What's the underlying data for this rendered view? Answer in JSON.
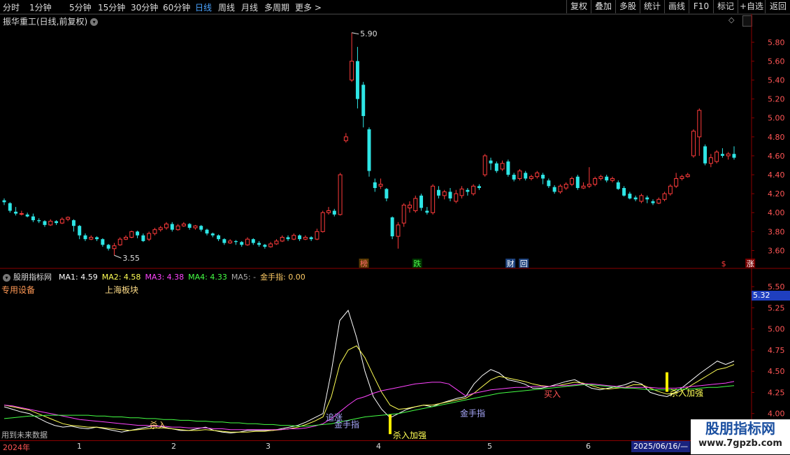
{
  "toolbar": {
    "tabs": [
      "分时",
      "1分钟",
      "5分钟",
      "15分钟",
      "30分钟",
      "60分钟",
      "日线",
      "周线",
      "月线",
      "多周期",
      "更多 >"
    ],
    "active_tab": "日线",
    "right_buttons": [
      "复权",
      "叠加",
      "多股",
      "统计",
      "画线",
      "F10",
      "标记",
      "+自选",
      "返回"
    ]
  },
  "stock": {
    "title": "振华重工(日线,前复权)",
    "high_label": "5.90",
    "low_label": "3.55"
  },
  "price_axis": [
    "5.80",
    "5.60",
    "5.40",
    "5.20",
    "5.00",
    "4.80",
    "4.60",
    "4.40",
    "4.20",
    "4.00",
    "3.80",
    "3.60"
  ],
  "price_range": [
    3.5,
    5.95
  ],
  "markers": [
    {
      "text": "榜",
      "color": "#ff6a6a",
      "bg": "#5a3a00",
      "index": 27
    },
    {
      "text": "跌",
      "color": "#4cff4c",
      "bg": "#003300",
      "index": 31
    },
    {
      "text": "财",
      "color": "#ffffff",
      "bg": "#1a3f7a",
      "index": 38
    },
    {
      "text": "回",
      "color": "#ffffff",
      "bg": "#1a3f7a",
      "index": 39
    },
    {
      "text": "$",
      "color": "#ff3a3a",
      "bg": "#000000",
      "index": 54
    },
    {
      "text": "涨",
      "color": "#ffffff",
      "bg": "#7a0000",
      "index": 56
    }
  ],
  "candles": [
    [
      4.13,
      4.11,
      4.15,
      4.08
    ],
    [
      4.1,
      4.02,
      4.11,
      4.0
    ],
    [
      4.01,
      3.99,
      4.06,
      3.97
    ],
    [
      3.99,
      3.99,
      4.02,
      3.97
    ],
    [
      3.98,
      3.96,
      4.0,
      3.95
    ],
    [
      3.96,
      3.92,
      3.99,
      3.9
    ],
    [
      3.92,
      3.91,
      3.94,
      3.89
    ],
    [
      3.91,
      3.87,
      3.92,
      3.85
    ],
    [
      3.87,
      3.91,
      3.93,
      3.86
    ],
    [
      3.91,
      3.89,
      3.92,
      3.87
    ],
    [
      3.89,
      3.93,
      3.95,
      3.88
    ],
    [
      3.93,
      3.95,
      3.96,
      3.91
    ],
    [
      3.92,
      3.86,
      3.93,
      3.8
    ],
    [
      3.86,
      3.76,
      3.87,
      3.72
    ],
    [
      3.76,
      3.72,
      3.78,
      3.7
    ],
    [
      3.72,
      3.74,
      3.76,
      3.71
    ],
    [
      3.74,
      3.72,
      3.75,
      3.7
    ],
    [
      3.72,
      3.66,
      3.73,
      3.64
    ],
    [
      3.66,
      3.62,
      3.67,
      3.6
    ],
    [
      3.62,
      3.65,
      3.68,
      3.55
    ],
    [
      3.66,
      3.72,
      3.74,
      3.65
    ],
    [
      3.72,
      3.74,
      3.76,
      3.71
    ],
    [
      3.74,
      3.8,
      3.81,
      3.73
    ],
    [
      3.8,
      3.76,
      3.81,
      3.73
    ],
    [
      3.76,
      3.7,
      3.78,
      3.69
    ],
    [
      3.72,
      3.78,
      3.8,
      3.7
    ],
    [
      3.78,
      3.82,
      3.84,
      3.76
    ],
    [
      3.82,
      3.84,
      3.86,
      3.8
    ],
    [
      3.84,
      3.88,
      3.9,
      3.82
    ],
    [
      3.88,
      3.82,
      3.9,
      3.8
    ],
    [
      3.82,
      3.86,
      3.88,
      3.81
    ],
    [
      3.86,
      3.88,
      3.9,
      3.85
    ],
    [
      3.88,
      3.84,
      3.89,
      3.82
    ],
    [
      3.84,
      3.86,
      3.87,
      3.82
    ],
    [
      3.86,
      3.82,
      3.87,
      3.8
    ],
    [
      3.82,
      3.78,
      3.83,
      3.76
    ],
    [
      3.78,
      3.76,
      3.79,
      3.74
    ],
    [
      3.76,
      3.72,
      3.77,
      3.7
    ],
    [
      3.72,
      3.68,
      3.73,
      3.66
    ],
    [
      3.68,
      3.7,
      3.72,
      3.67
    ],
    [
      3.7,
      3.69,
      3.71,
      3.66
    ],
    [
      3.69,
      3.66,
      3.7,
      3.64
    ],
    [
      3.66,
      3.72,
      3.74,
      3.65
    ],
    [
      3.72,
      3.68,
      3.73,
      3.66
    ],
    [
      3.68,
      3.66,
      3.7,
      3.64
    ],
    [
      3.66,
      3.64,
      3.67,
      3.62
    ],
    [
      3.64,
      3.67,
      3.69,
      3.63
    ],
    [
      3.67,
      3.7,
      3.72,
      3.66
    ],
    [
      3.7,
      3.74,
      3.76,
      3.69
    ],
    [
      3.74,
      3.72,
      3.76,
      3.7
    ],
    [
      3.72,
      3.76,
      3.78,
      3.71
    ],
    [
      3.76,
      3.72,
      3.77,
      3.7
    ],
    [
      3.72,
      3.74,
      3.76,
      3.71
    ],
    [
      3.74,
      3.72,
      3.75,
      3.7
    ],
    [
      3.72,
      3.8,
      3.83,
      3.71
    ],
    [
      3.8,
      4.0,
      4.02,
      3.79
    ],
    [
      4.0,
      4.02,
      4.06,
      3.98
    ],
    [
      4.02,
      3.98,
      4.04,
      3.96
    ],
    [
      3.98,
      4.4,
      4.42,
      3.97
    ],
    [
      4.76,
      4.8,
      4.84,
      4.74
    ],
    [
      5.4,
      5.6,
      5.9,
      5.38
    ],
    [
      5.6,
      5.2,
      5.75,
      5.1
    ],
    [
      5.35,
      5.02,
      5.38,
      4.9
    ],
    [
      4.88,
      4.44,
      4.9,
      4.38
    ],
    [
      4.32,
      4.26,
      4.36,
      4.22
    ],
    [
      4.28,
      4.3,
      4.36,
      4.25
    ],
    [
      4.25,
      4.15,
      4.26,
      4.12
    ],
    [
      3.95,
      3.75,
      3.96,
      3.72
    ],
    [
      3.75,
      3.87,
      3.9,
      3.62
    ],
    [
      3.89,
      4.08,
      4.1,
      3.85
    ],
    [
      4.05,
      4.08,
      4.12,
      4.0
    ],
    [
      4.02,
      4.15,
      4.18,
      4.0
    ],
    [
      4.18,
      4.05,
      4.2,
      4.02
    ],
    [
      4.02,
      4.0,
      4.06,
      3.98
    ],
    [
      4.0,
      4.28,
      4.3,
      3.98
    ],
    [
      4.24,
      4.18,
      4.28,
      4.15
    ],
    [
      4.18,
      4.22,
      4.24,
      4.14
    ],
    [
      4.22,
      4.15,
      4.26,
      4.12
    ],
    [
      4.12,
      4.2,
      4.24,
      4.1
    ],
    [
      4.18,
      4.25,
      4.28,
      4.15
    ],
    [
      4.24,
      4.22,
      4.26,
      4.18
    ],
    [
      4.2,
      4.28,
      4.3,
      4.18
    ],
    [
      4.28,
      4.26,
      4.3,
      4.24
    ],
    [
      4.4,
      4.6,
      4.62,
      4.38
    ],
    [
      4.55,
      4.52,
      4.58,
      4.45
    ],
    [
      4.52,
      4.44,
      4.54,
      4.42
    ],
    [
      4.46,
      4.52,
      4.55,
      4.44
    ],
    [
      4.54,
      4.4,
      4.56,
      4.38
    ],
    [
      4.4,
      4.35,
      4.42,
      4.33
    ],
    [
      4.36,
      4.44,
      4.46,
      4.34
    ],
    [
      4.42,
      4.36,
      4.44,
      4.34
    ],
    [
      4.36,
      4.38,
      4.4,
      4.34
    ],
    [
      4.38,
      4.42,
      4.44,
      4.36
    ],
    [
      4.4,
      4.36,
      4.42,
      4.3
    ],
    [
      4.34,
      4.28,
      4.36,
      4.26
    ],
    [
      4.27,
      4.22,
      4.29,
      4.2
    ],
    [
      4.22,
      4.28,
      4.3,
      4.2
    ],
    [
      4.26,
      4.3,
      4.32,
      4.24
    ],
    [
      4.3,
      4.36,
      4.38,
      4.28
    ],
    [
      4.38,
      4.26,
      4.4,
      4.24
    ],
    [
      4.26,
      4.28,
      4.32,
      4.25
    ],
    [
      4.28,
      4.3,
      4.48,
      4.26
    ],
    [
      4.3,
      4.36,
      4.38,
      4.28
    ],
    [
      4.36,
      4.38,
      4.4,
      4.34
    ],
    [
      4.38,
      4.34,
      4.4,
      4.32
    ],
    [
      4.34,
      4.36,
      4.38,
      4.32
    ],
    [
      4.32,
      4.25,
      4.34,
      4.24
    ],
    [
      4.26,
      4.18,
      4.28,
      4.17
    ],
    [
      4.2,
      4.15,
      4.22,
      4.14
    ],
    [
      4.16,
      4.14,
      4.18,
      4.12
    ],
    [
      4.12,
      4.18,
      4.2,
      4.1
    ],
    [
      4.16,
      4.14,
      4.18,
      4.1
    ],
    [
      4.12,
      4.1,
      4.14,
      4.08
    ],
    [
      4.1,
      4.14,
      4.16,
      4.09
    ],
    [
      4.14,
      4.2,
      4.22,
      4.12
    ],
    [
      4.2,
      4.28,
      4.3,
      4.18
    ],
    [
      4.28,
      4.36,
      4.42,
      4.26
    ],
    [
      4.36,
      4.38,
      4.4,
      4.34
    ],
    [
      4.38,
      4.4,
      4.42,
      4.37
    ],
    [
      4.6,
      4.86,
      4.88,
      4.58
    ],
    [
      4.8,
      5.08,
      5.1,
      4.6
    ],
    [
      4.7,
      4.52,
      4.72,
      4.5
    ],
    [
      4.52,
      4.58,
      4.62,
      4.48
    ],
    [
      4.54,
      4.64,
      4.66,
      4.52
    ],
    [
      4.62,
      4.6,
      4.68,
      4.58
    ],
    [
      4.6,
      4.62,
      4.64,
      4.56
    ],
    [
      4.62,
      4.58,
      4.7,
      4.56
    ]
  ],
  "indicator": {
    "name": "股朋指标网",
    "ma_values": [
      {
        "label": "MA1: 4.59",
        "color": "#ffffff"
      },
      {
        "label": "MA2: 4.58",
        "color": "#ffff55"
      },
      {
        "label": "MA3: 4.38",
        "color": "#ff44ff"
      },
      {
        "label": "MA4: 4.33",
        "color": "#44ff44"
      },
      {
        "label": "MA5: -",
        "color": "#aaaaaa"
      },
      {
        "label": "金手指: 0.00",
        "color": "#ffcc66"
      }
    ],
    "sector1": "专用设备",
    "sector2": "上海板块",
    "axis": [
      "5.50",
      "5.25",
      "5.00",
      "4.75",
      "4.50",
      "4.25",
      "4.00"
    ],
    "current_price": "5.32",
    "range": [
      3.7,
      5.6
    ],
    "signal_labels": [
      {
        "text": "杀入",
        "color": "#ffcc66",
        "index": 17,
        "value": 3.86
      },
      {
        "text": "追涨",
        "color": "#aaaaff",
        "index": 38,
        "value": 3.95
      },
      {
        "text": "金手指",
        "color": "#aaaaff",
        "index": 39,
        "value": 3.87
      },
      {
        "text": "杀入加强",
        "color": "#ffff55",
        "index": 46,
        "value": 3.74
      },
      {
        "text": "金手指",
        "color": "#aaaaff",
        "index": 54,
        "value": 4.0
      },
      {
        "text": "买入",
        "color": "#ff5555",
        "index": 64,
        "value": 4.23
      },
      {
        "text": "杀入加强",
        "color": "#ffff55",
        "index": 79,
        "value": 4.24
      }
    ],
    "footer_note": "用到未来数据",
    "lines": {
      "white": [
        4.08,
        4.05,
        4.02,
        4.0,
        3.95,
        3.9,
        3.86,
        3.84,
        3.85,
        3.83,
        3.82,
        3.84,
        3.82,
        3.8,
        3.78,
        3.8,
        3.82,
        3.84,
        3.86,
        3.84,
        3.82,
        3.8,
        3.8,
        3.82,
        3.84,
        3.8,
        3.78,
        3.77,
        3.78,
        3.8,
        3.8,
        3.8,
        3.8,
        3.82,
        3.84,
        3.86,
        3.9,
        3.95,
        4.0,
        4.5,
        5.1,
        5.22,
        4.9,
        4.5,
        4.2,
        4.05,
        3.95,
        4.0,
        4.05,
        4.08,
        4.1,
        4.08,
        4.12,
        4.15,
        4.18,
        4.2,
        4.35,
        4.45,
        4.52,
        4.48,
        4.4,
        4.38,
        4.35,
        4.3,
        4.3,
        4.32,
        4.35,
        4.38,
        4.4,
        4.35,
        4.3,
        4.28,
        4.3,
        4.32,
        4.34,
        4.38,
        4.35,
        4.25,
        4.22,
        4.2,
        4.25,
        4.32,
        4.4,
        4.48,
        4.55,
        4.62,
        4.58,
        4.62
      ],
      "yellow": [
        4.1,
        4.08,
        4.06,
        4.04,
        4.0,
        3.96,
        3.92,
        3.88,
        3.86,
        3.85,
        3.84,
        3.84,
        3.83,
        3.82,
        3.81,
        3.8,
        3.81,
        3.82,
        3.83,
        3.83,
        3.82,
        3.81,
        3.8,
        3.8,
        3.81,
        3.8,
        3.79,
        3.78,
        3.78,
        3.78,
        3.79,
        3.79,
        3.8,
        3.81,
        3.82,
        3.84,
        3.87,
        3.91,
        3.96,
        4.2,
        4.58,
        4.75,
        4.8,
        4.66,
        4.45,
        4.25,
        4.1,
        4.05,
        4.06,
        4.08,
        4.1,
        4.1,
        4.12,
        4.14,
        4.16,
        4.18,
        4.24,
        4.32,
        4.4,
        4.44,
        4.42,
        4.4,
        4.38,
        4.35,
        4.33,
        4.32,
        4.33,
        4.35,
        4.37,
        4.36,
        4.33,
        4.3,
        4.29,
        4.3,
        4.31,
        4.34,
        4.34,
        4.3,
        4.26,
        4.23,
        4.24,
        4.28,
        4.34,
        4.4,
        4.46,
        4.52,
        4.54,
        4.58
      ],
      "magenta": [
        4.1,
        4.09,
        4.07,
        4.05,
        4.03,
        4.01,
        3.99,
        3.97,
        3.95,
        3.93,
        3.92,
        3.91,
        3.9,
        3.89,
        3.88,
        3.87,
        3.86,
        3.86,
        3.85,
        3.85,
        3.84,
        3.84,
        3.83,
        3.83,
        3.83,
        3.82,
        3.82,
        3.81,
        3.81,
        3.81,
        3.81,
        3.81,
        3.81,
        3.81,
        3.82,
        3.82,
        3.83,
        3.85,
        3.88,
        3.94,
        4.02,
        4.1,
        4.17,
        4.2,
        4.24,
        4.27,
        4.29,
        4.31,
        4.33,
        4.35,
        4.36,
        4.37,
        4.37,
        4.35,
        4.28,
        4.21,
        4.24,
        4.26,
        4.28,
        4.29,
        4.3,
        4.31,
        4.31,
        4.32,
        4.32,
        4.32,
        4.33,
        4.33,
        4.34,
        4.35,
        4.35,
        4.34,
        4.33,
        4.32,
        4.31,
        4.31,
        4.31,
        4.31,
        4.3,
        4.3,
        4.3,
        4.31,
        4.32,
        4.33,
        4.34,
        4.35,
        4.36,
        4.38
      ],
      "green": [
        3.94,
        3.95,
        3.96,
        3.97,
        3.97,
        3.98,
        3.98,
        3.98,
        3.98,
        3.98,
        3.98,
        3.97,
        3.97,
        3.96,
        3.96,
        3.95,
        3.95,
        3.94,
        3.94,
        3.93,
        3.93,
        3.92,
        3.92,
        3.91,
        3.91,
        3.9,
        3.9,
        3.89,
        3.89,
        3.88,
        3.88,
        3.87,
        3.87,
        3.86,
        3.86,
        3.85,
        3.85,
        3.86,
        3.87,
        3.88,
        3.9,
        3.92,
        3.94,
        3.96,
        3.97,
        3.98,
        3.99,
        4.0,
        4.02,
        4.04,
        4.06,
        4.08,
        4.1,
        4.12,
        4.14,
        4.16,
        4.18,
        4.2,
        4.22,
        4.24,
        4.25,
        4.26,
        4.27,
        4.28,
        4.29,
        4.3,
        4.31,
        4.32,
        4.33,
        4.34,
        4.34,
        4.33,
        4.32,
        4.31,
        4.3,
        4.3,
        4.29,
        4.28,
        4.28,
        4.28,
        4.28,
        4.29,
        4.29,
        4.3,
        4.31,
        4.31,
        4.32,
        4.33
      ]
    }
  },
  "date_axis": {
    "start_label": "2024年",
    "ticks": [
      "1",
      "2",
      "3",
      "4",
      "5",
      "6"
    ],
    "current_date": "2025/06/16/—"
  },
  "watermark": {
    "line1": "股朋指标网",
    "line2": "www.7gpzb.com"
  }
}
